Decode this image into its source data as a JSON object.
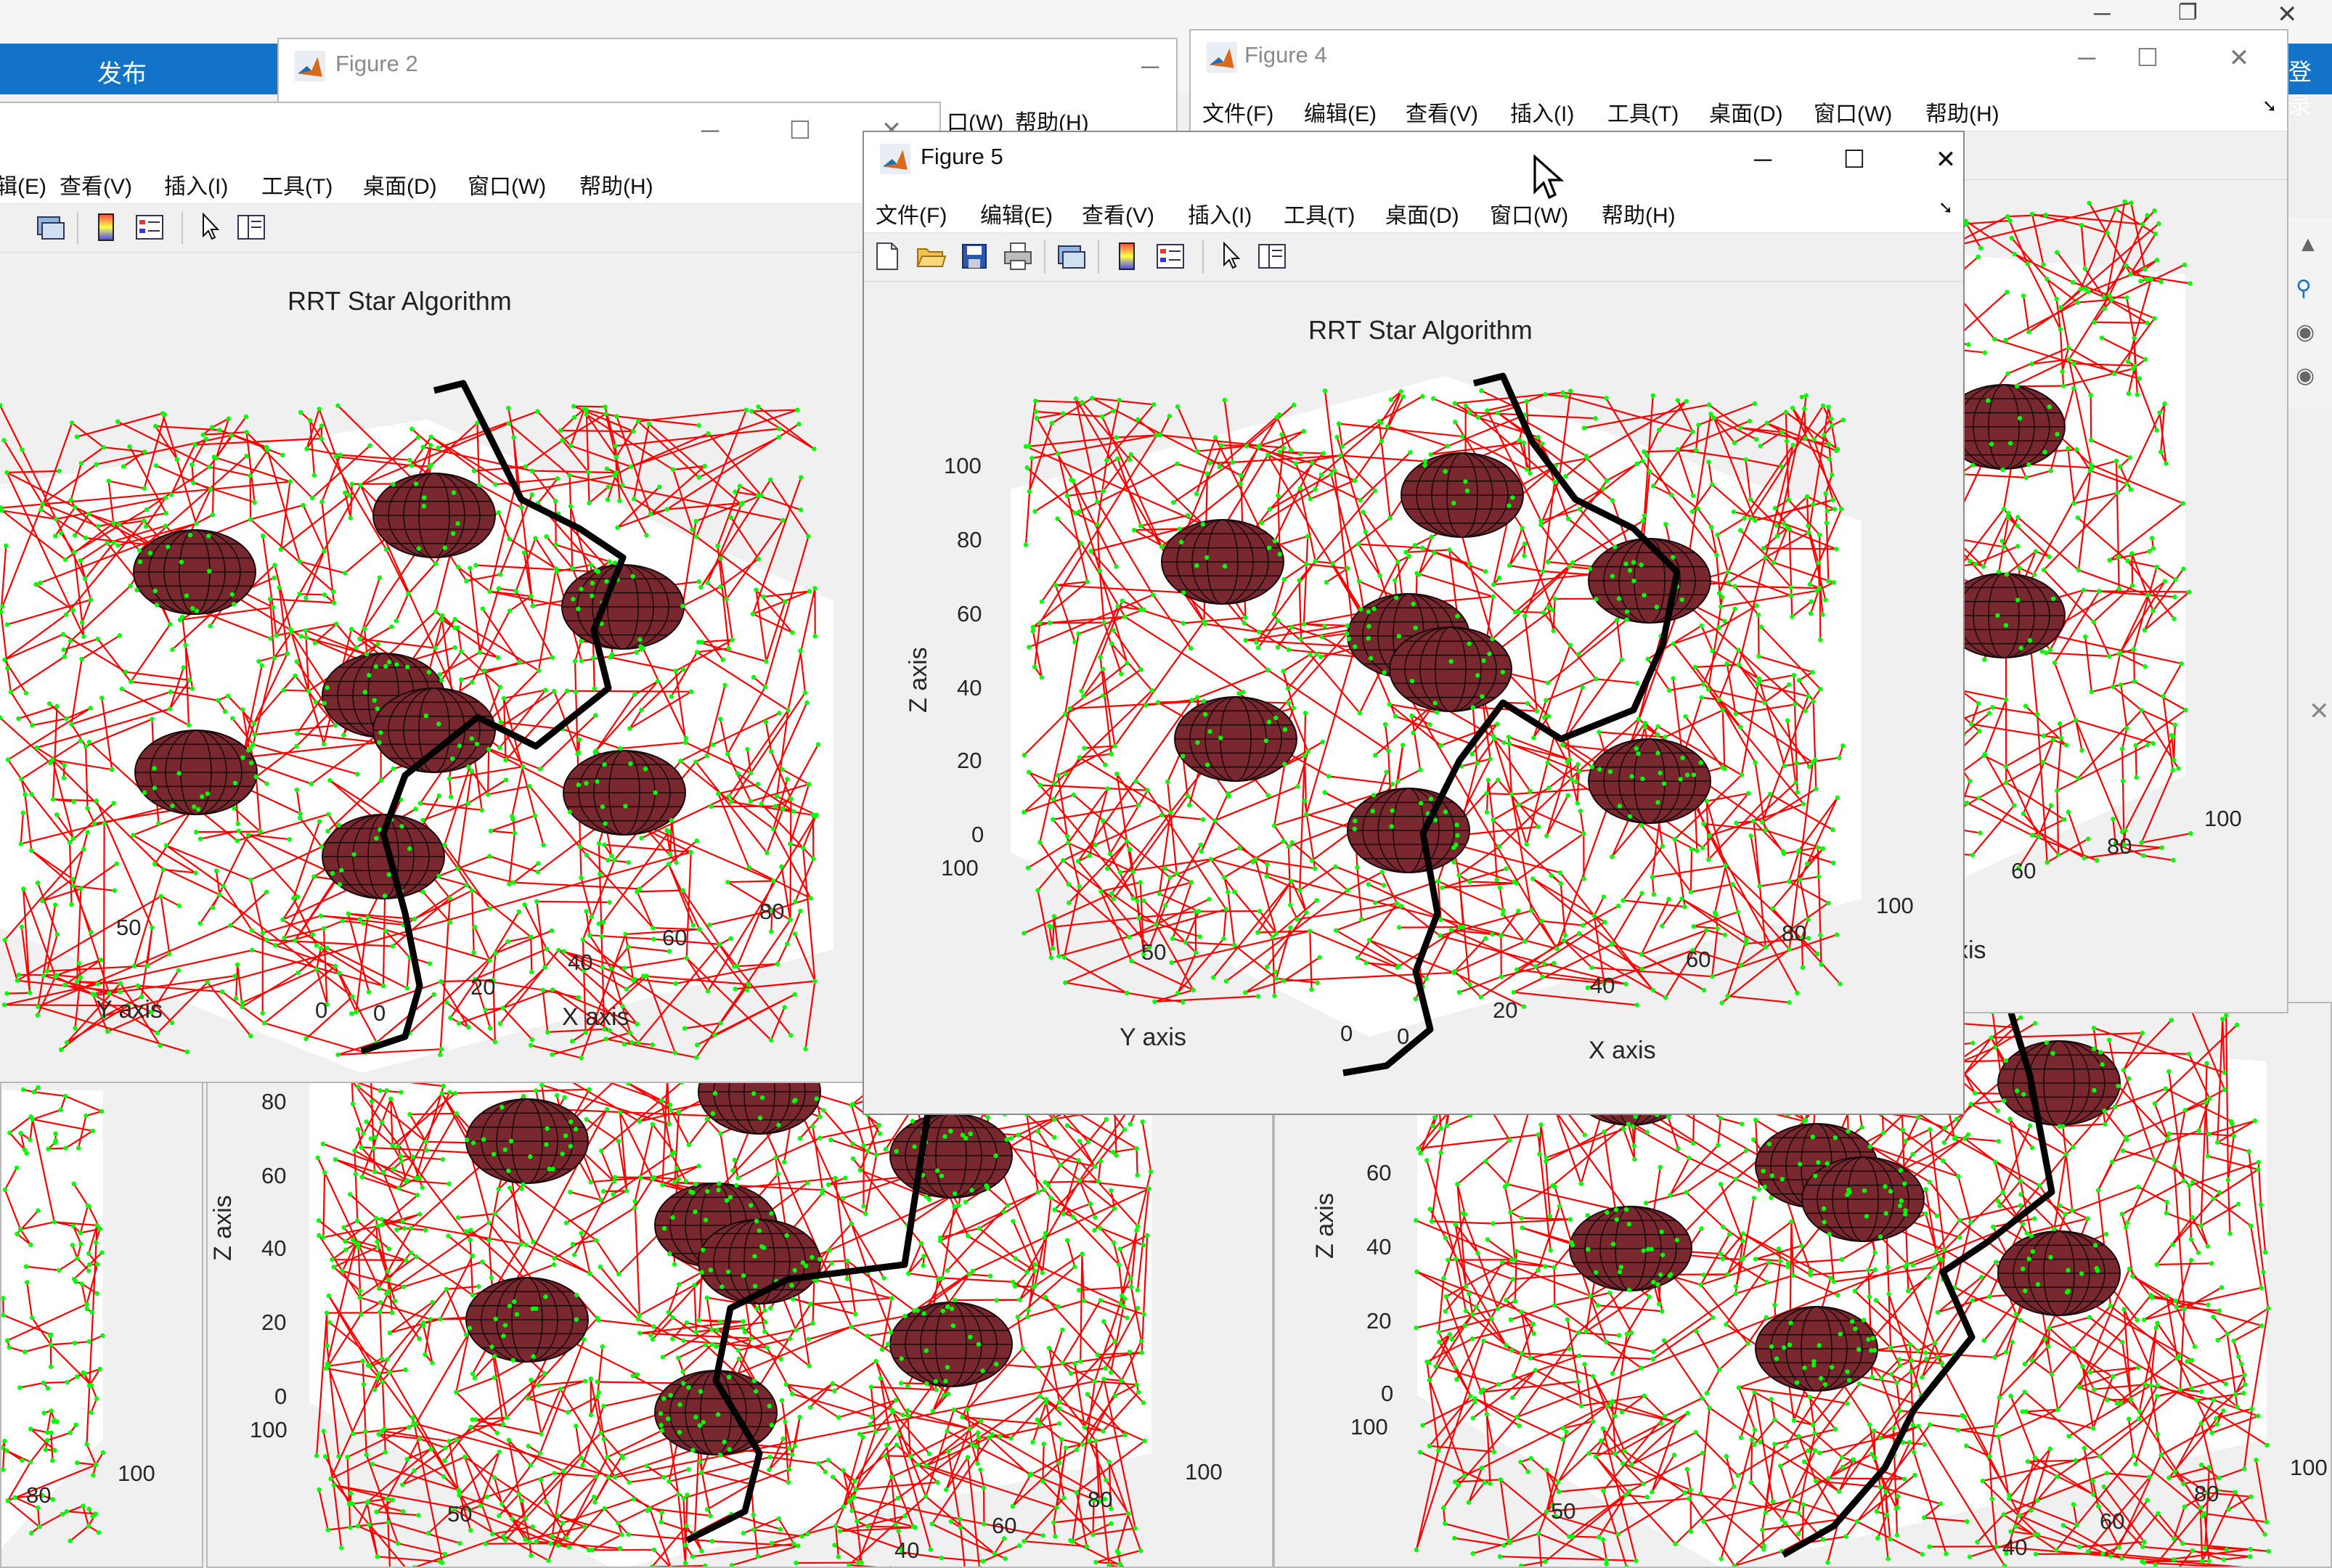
{
  "background_app": {
    "tab_label": "发布",
    "right_button": "登录",
    "accent": "#1273c8"
  },
  "windows": {
    "fig2": {
      "title": "Figure 2"
    },
    "fig4": {
      "title": "Figure 4"
    },
    "fig5": {
      "title": "Figure 5"
    },
    "back_left": {
      "title": ""
    }
  },
  "menus": {
    "full": [
      "文件(F)",
      "编辑(E)",
      "查看(V)",
      "插入(I)",
      "工具(T)",
      "桌面(D)",
      "窗口(W)",
      "帮助(H)"
    ],
    "left_partial": [
      "辑(E)",
      "查看(V)",
      "插入(I)",
      "工具(T)",
      "桌面(D)",
      "窗口(W)",
      "帮助(H)"
    ],
    "fig2_partial": [
      "口(W)",
      "帮助(H)"
    ]
  },
  "toolbar_icons": [
    "new-file-icon",
    "open-folder-icon",
    "save-icon",
    "print-icon",
    "link-plot-icon",
    "colorbar-icon",
    "legend-icon",
    "pointer-icon",
    "property-inspector-icon"
  ],
  "chart_data": {
    "type": "scatter",
    "title": "RRT Star Algorithm",
    "xlabel": "X axis",
    "ylabel": "Y axis",
    "zlabel": "Z axis",
    "xlim": [
      0,
      100
    ],
    "ylim": [
      0,
      100
    ],
    "zlim": [
      0,
      100
    ],
    "x_ticks": [
      "0",
      "20",
      "40",
      "60",
      "80",
      "100"
    ],
    "y_ticks": [
      "0",
      "50",
      "100"
    ],
    "z_ticks": [
      "0",
      "20",
      "40",
      "60",
      "80",
      "100"
    ],
    "tree_color": "#ff0000",
    "node_color": "#00ff00",
    "path_color": "#000000",
    "obstacle_color": "#7a2830",
    "obstacle_count": 8
  },
  "partial_ticks": {
    "left_y": "50",
    "left_y0": "0",
    "left_x": [
      "0",
      "20",
      "40",
      "60",
      "80"
    ],
    "right_x": [
      "60",
      "80",
      "100"
    ],
    "right_axis_suffix": "xis",
    "bottom_z": [
      "80",
      "60",
      "40",
      "20",
      "0"
    ],
    "bottom_z2": [
      "60",
      "40",
      "20",
      "0"
    ],
    "bottom_y": [
      "100",
      "80"
    ],
    "bottom_y2": [
      "100",
      "50"
    ],
    "bottom_x": [
      "40",
      "60",
      "80",
      "100"
    ],
    "bottom_x2": [
      "40",
      "60",
      "80",
      "100"
    ]
  }
}
